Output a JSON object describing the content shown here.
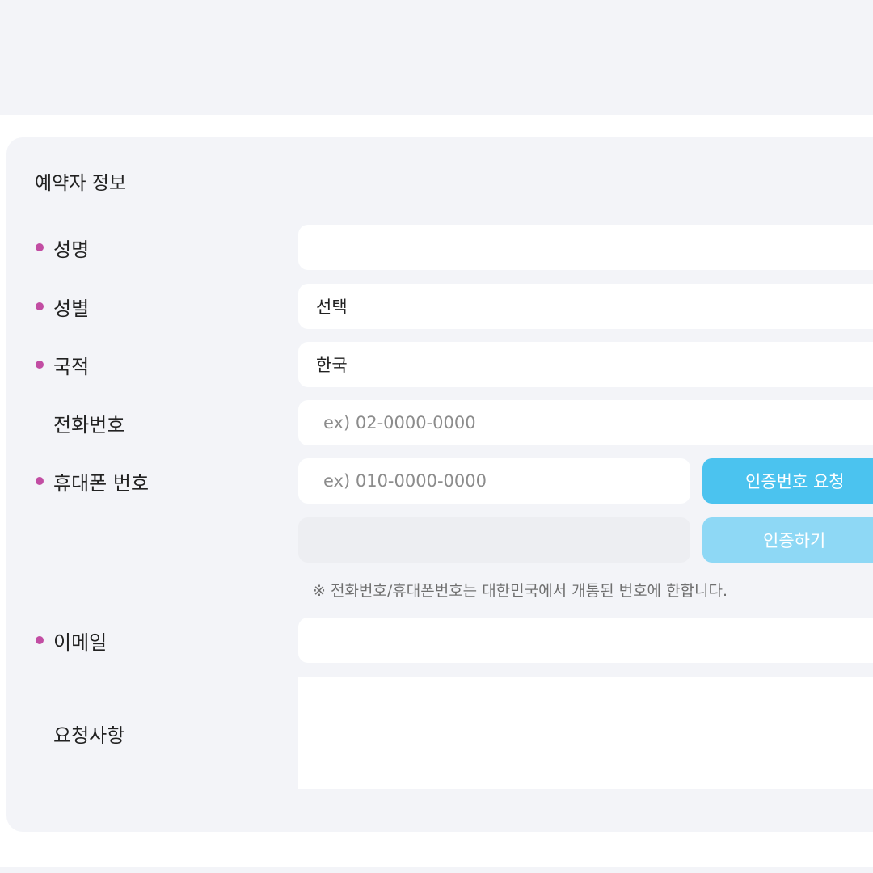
{
  "section": {
    "title": "예약자 정보"
  },
  "form": {
    "name": {
      "label": "성명",
      "value": ""
    },
    "gender": {
      "label": "성별",
      "value": "선택"
    },
    "nationality": {
      "label": "국적",
      "value": "한국"
    },
    "phone": {
      "label": "전화번호",
      "placeholder": "ex) 02-0000-0000"
    },
    "mobile": {
      "label": "휴대폰 번호",
      "placeholder": "ex) 010-0000-0000",
      "request_button": "인증번호 요청",
      "verify_button": "인증하기",
      "code_value": ""
    },
    "notice": "※ 전화번호/휴대폰번호는 대한민국에서 개통된 번호에 한합니다.",
    "email": {
      "label": "이메일",
      "value": ""
    },
    "request": {
      "label": "요청사항",
      "value": ""
    }
  },
  "colors": {
    "required_dot": "#c24da3",
    "primary_button": "#4bc3ef",
    "disabled_button": "#8ed8f5",
    "panel_background": "#f3f4f8"
  }
}
